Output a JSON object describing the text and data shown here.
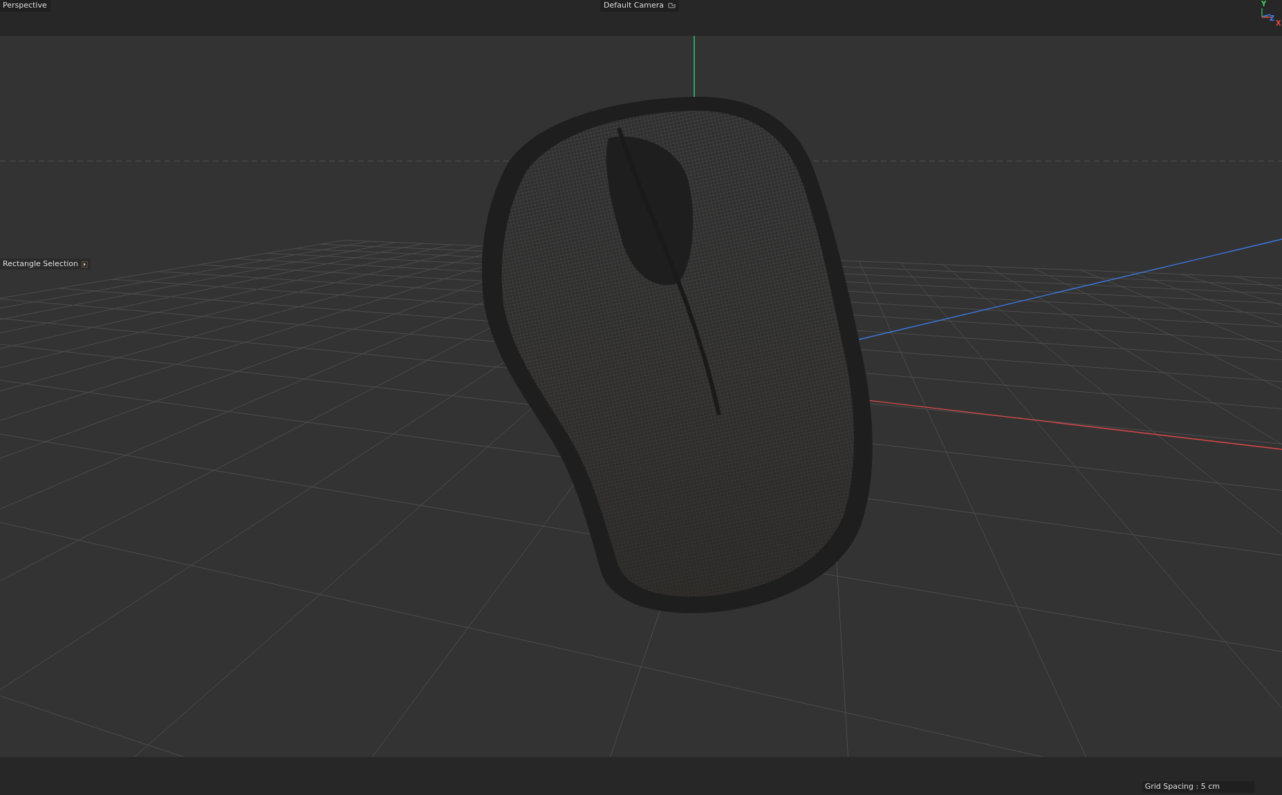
{
  "viewport": {
    "view_name": "Perspective",
    "camera": "Default Camera",
    "tool": "Rectangle Selection",
    "grid_spacing": "Grid Spacing : 5 cm"
  },
  "axis_gizmo": [
    {
      "label": "Y",
      "color": "#3ecf5e"
    },
    {
      "label": "Z",
      "color": "#3d7be8"
    },
    {
      "label": "X",
      "color": "#e04848"
    }
  ]
}
